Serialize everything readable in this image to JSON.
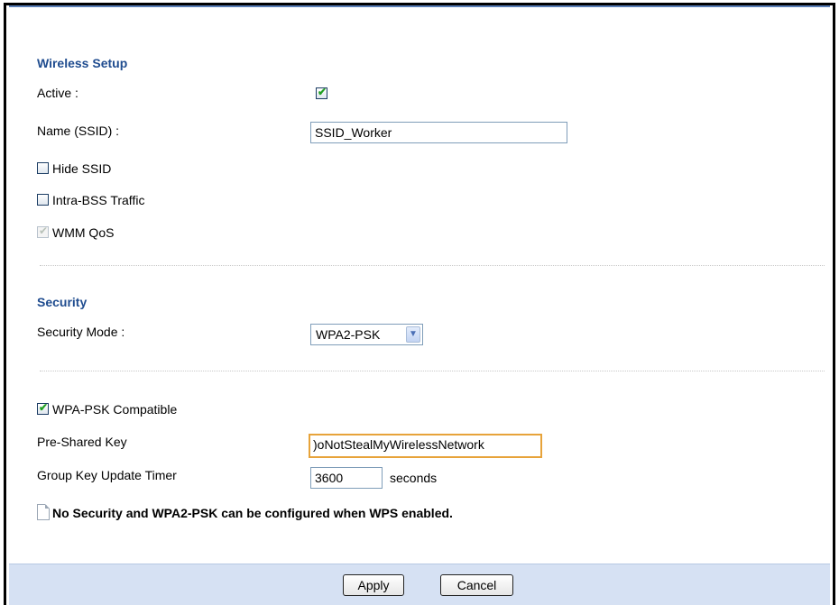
{
  "wireless_setup": {
    "title": "Wireless Setup",
    "active_label": "Active :",
    "active_checked": true,
    "ssid_label": "Name (SSID) :",
    "ssid_value": "SSID_Worker",
    "hide_ssid_label": "Hide SSID",
    "hide_ssid_checked": false,
    "intra_bss_label": "Intra-BSS Traffic",
    "intra_bss_checked": false,
    "wmm_qos_label": "WMM QoS",
    "wmm_qos_checked": true,
    "wmm_qos_disabled": true
  },
  "security": {
    "title": "Security",
    "mode_label": "Security Mode :",
    "mode_value": "WPA2-PSK",
    "wpa_psk_compatible_label": "WPA-PSK Compatible",
    "wpa_psk_compatible_checked": true,
    "psk_label": "Pre-Shared Key",
    "psk_value": ")oNotStealMyWirelessNetwork",
    "group_key_label": "Group Key Update Timer",
    "group_key_value": "3600",
    "group_key_unit": "seconds",
    "note": "No Security and WPA2-PSK can be configured when WPS enabled."
  },
  "footer": {
    "apply_label": "Apply",
    "cancel_label": "Cancel"
  },
  "icons": {
    "check": "checkmark-icon",
    "dropdown": "chevron-down-icon",
    "note": "note-icon"
  },
  "colors": {
    "section_title": "#1f4c8f",
    "footer_bg": "#d6e1f3",
    "focus_border": "#e7a33a",
    "check": "#22a022"
  }
}
